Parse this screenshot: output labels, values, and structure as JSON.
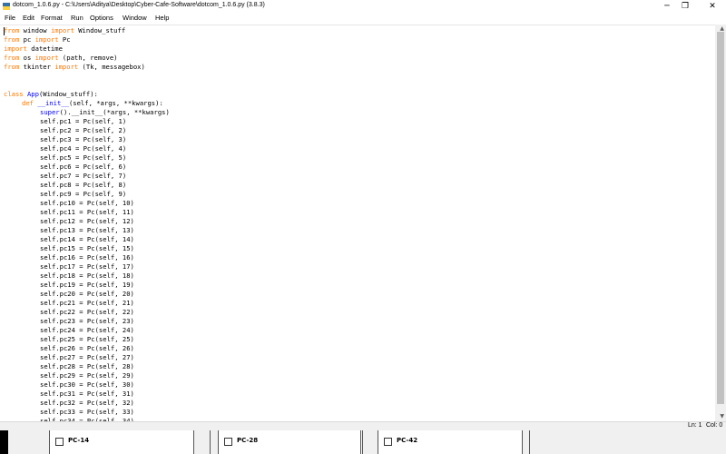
{
  "window": {
    "title": "dotcom_1.0.6.py - C:\\Users\\Aditya\\Desktop\\Cyber-Cafe-Software\\dotcom_1.0.6.py (3.8.3)",
    "minimize": "─",
    "maximize": "❐",
    "close": "✕"
  },
  "menu": [
    "File",
    "Edit",
    "Format",
    "Run",
    "Options",
    "Window",
    "Help"
  ],
  "code": {
    "imports": [
      {
        "kw1": "from",
        "mod": " window ",
        "kw2": "import",
        "rest": " Window_stuff"
      },
      {
        "kw1": "from",
        "mod": " pc ",
        "kw2": "import",
        "rest": " Pc"
      },
      {
        "kw1": "import",
        "mod": " datetime",
        "kw2": "",
        "rest": ""
      },
      {
        "kw1": "from",
        "mod": " os ",
        "kw2": "import",
        "rest": " (path, remove)"
      },
      {
        "kw1": "from",
        "mod": " tkinter ",
        "kw2": "import",
        "rest": " (Tk, messagebox)"
      }
    ],
    "class_kw": "class",
    "class_name": " App",
    "class_rest": "(Window_stuff):",
    "def_kw": "def",
    "def_name": " __init__",
    "def_rest": "(self, *args, **kwargs):",
    "super_line": "super().__init__(*args, **kwargs)",
    "pc_count": 34
  },
  "status": {
    "line": "Ln: 1",
    "col": "Col: 0"
  },
  "taskbar": {
    "tiles": [
      "PC-14",
      "PC-28",
      "PC-42"
    ]
  }
}
